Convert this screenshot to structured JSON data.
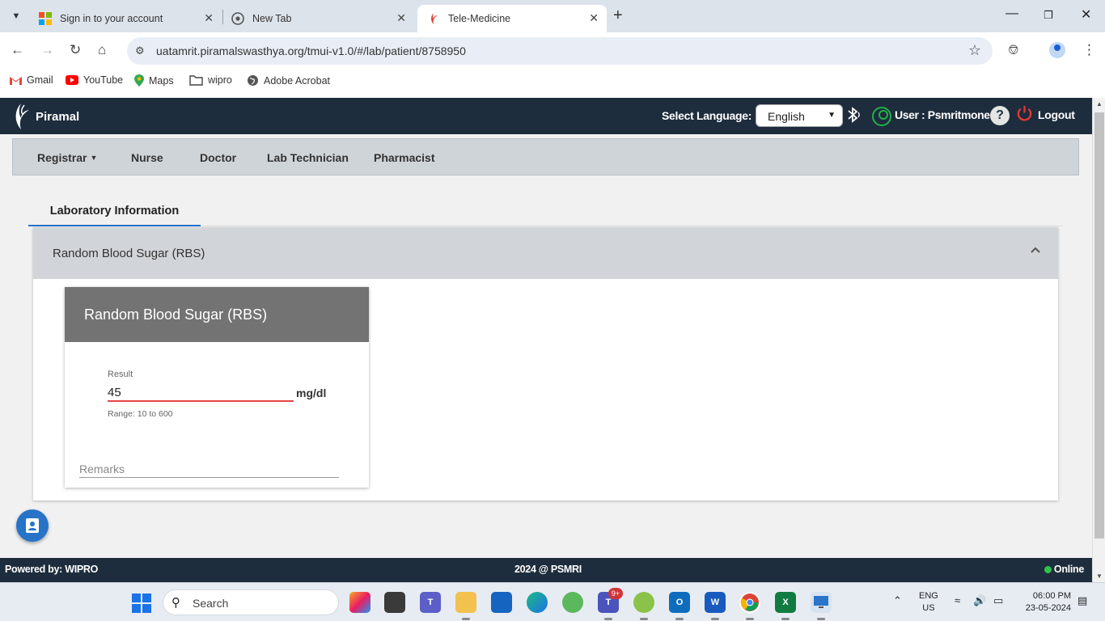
{
  "browser": {
    "tabs": [
      {
        "title": "Sign in to your account",
        "favicon": "microsoft-icon"
      },
      {
        "title": "New Tab",
        "favicon": "chrome-icon"
      },
      {
        "title": "Tele-Medicine",
        "favicon": "piramal-icon"
      }
    ],
    "url": "uatamrit.piramalswasthya.org/tmui-v1.0/#/lab/patient/8758950",
    "bookmarks": [
      "Gmail",
      "YouTube",
      "Maps",
      "wipro",
      "Adobe Acrobat"
    ]
  },
  "header": {
    "brand": "Piramal",
    "language_label": "Select Language:",
    "language_value": "English",
    "user_label": "User : Psmritmone",
    "logout_label": "Logout"
  },
  "nav": {
    "roles": [
      "Registrar",
      "Nurse",
      "Doctor",
      "Lab Technician",
      "Pharmacist"
    ]
  },
  "section": {
    "tab_label": "Laboratory Information",
    "panel_title": "Random Blood Sugar (RBS)",
    "card_title": "Random Blood Sugar (RBS)",
    "result_label": "Result",
    "result_value": "45",
    "unit": "mg/dl",
    "range_text": "Range: 10 to 600",
    "remarks_placeholder": "Remarks"
  },
  "footer": {
    "left": "Powered by: WIPRO",
    "center": "2024 @ PSMRI",
    "status": "Online"
  },
  "taskbar": {
    "search_placeholder": "Search",
    "teams_badge": "9+",
    "lang_line1": "ENG",
    "lang_line2": "US",
    "time": "06:00 PM",
    "date": "23-05-2024"
  },
  "colors": {
    "header_bg": "#1e2d3d",
    "accent_blue": "#2673c8",
    "error_red": "#e54545",
    "online_green": "#2ec44a"
  }
}
